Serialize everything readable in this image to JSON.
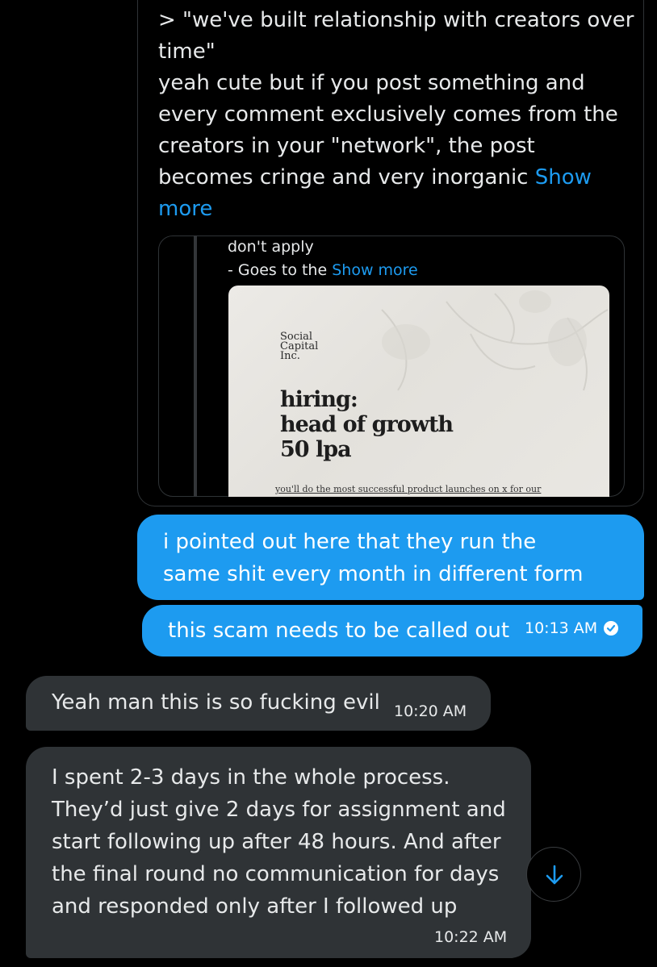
{
  "shared_post": {
    "lines": [
      "> \"we've built relationship with creators over time\"",
      " yeah cute but if you post something and every comment exclusively comes from the creators in your \"network\", the post becomes cringe and very inorganic"
    ],
    "show_more": "Show more",
    "quoted": {
      "line1": "don't apply",
      "line2": "- Goes to the",
      "show_more": "Show more",
      "poster": {
        "logo_lines": [
          "Social",
          "Capital",
          "Inc."
        ],
        "headline_lines": [
          "hiring:",
          "head of growth",
          "50 lpa"
        ],
        "footer": "you'll do the most successful product launches on x for our"
      }
    }
  },
  "messages": {
    "sent": [
      {
        "text": "i pointed out here that they run the same shit every month in different form"
      },
      {
        "text": "this scam needs to be called out",
        "time": "10:13 AM"
      }
    ],
    "received": [
      {
        "text": "Yeah man this is so fucking evil",
        "time": "10:20 AM"
      },
      {
        "lines": [
          "I spent 2-3 days in the whole process.",
          "They’d just give 2 days for assignment and",
          "start following up after 48 hours. And after",
          "the final round no communication for days",
          "and responded only after I followed up"
        ],
        "time": "10:22 AM"
      }
    ]
  },
  "colors": {
    "accent": "#1d9bf0",
    "received_bubble": "#2f3336",
    "background": "#000000"
  },
  "icons": {
    "scroll_down": "arrow-down-icon",
    "read_receipt": "check-circle-icon"
  }
}
